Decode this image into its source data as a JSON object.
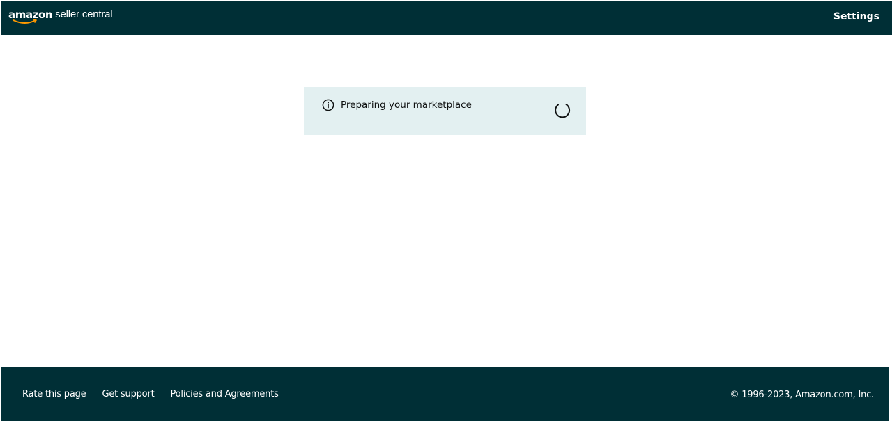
{
  "header": {
    "logo_brand": "amazon",
    "logo_sub": "seller central",
    "settings_label": "Settings",
    "background_color": "#002f36"
  },
  "alert": {
    "icon": "info-circle-icon",
    "message": "Preparing your marketplace",
    "background_color": "#e3f0f1",
    "status": "loading"
  },
  "footer": {
    "links": [
      {
        "label": "Rate this page"
      },
      {
        "label": "Get support"
      },
      {
        "label": "Policies and Agreements"
      }
    ],
    "copyright": "© 1996-2023, Amazon.com, Inc."
  },
  "colors": {
    "dark_teal": "#002f36",
    "alert_bg": "#e3f0f1",
    "logo_smile": "#ff9900",
    "text_dark": "#0f1111"
  }
}
